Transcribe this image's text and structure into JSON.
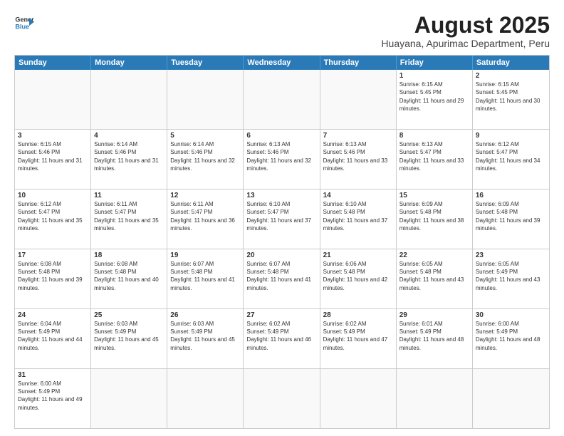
{
  "logo": {
    "line1": "General",
    "line2": "Blue"
  },
  "title": "August 2025",
  "subtitle": "Huayana, Apurimac Department, Peru",
  "headers": [
    "Sunday",
    "Monday",
    "Tuesday",
    "Wednesday",
    "Thursday",
    "Friday",
    "Saturday"
  ],
  "weeks": [
    [
      {
        "day": "",
        "info": ""
      },
      {
        "day": "",
        "info": ""
      },
      {
        "day": "",
        "info": ""
      },
      {
        "day": "",
        "info": ""
      },
      {
        "day": "",
        "info": ""
      },
      {
        "day": "1",
        "info": "Sunrise: 6:15 AM\nSunset: 5:45 PM\nDaylight: 11 hours and 29 minutes."
      },
      {
        "day": "2",
        "info": "Sunrise: 6:15 AM\nSunset: 5:45 PM\nDaylight: 11 hours and 30 minutes."
      }
    ],
    [
      {
        "day": "3",
        "info": "Sunrise: 6:15 AM\nSunset: 5:46 PM\nDaylight: 11 hours and 31 minutes."
      },
      {
        "day": "4",
        "info": "Sunrise: 6:14 AM\nSunset: 5:46 PM\nDaylight: 11 hours and 31 minutes."
      },
      {
        "day": "5",
        "info": "Sunrise: 6:14 AM\nSunset: 5:46 PM\nDaylight: 11 hours and 32 minutes."
      },
      {
        "day": "6",
        "info": "Sunrise: 6:13 AM\nSunset: 5:46 PM\nDaylight: 11 hours and 32 minutes."
      },
      {
        "day": "7",
        "info": "Sunrise: 6:13 AM\nSunset: 5:46 PM\nDaylight: 11 hours and 33 minutes."
      },
      {
        "day": "8",
        "info": "Sunrise: 6:13 AM\nSunset: 5:47 PM\nDaylight: 11 hours and 33 minutes."
      },
      {
        "day": "9",
        "info": "Sunrise: 6:12 AM\nSunset: 5:47 PM\nDaylight: 11 hours and 34 minutes."
      }
    ],
    [
      {
        "day": "10",
        "info": "Sunrise: 6:12 AM\nSunset: 5:47 PM\nDaylight: 11 hours and 35 minutes."
      },
      {
        "day": "11",
        "info": "Sunrise: 6:11 AM\nSunset: 5:47 PM\nDaylight: 11 hours and 35 minutes."
      },
      {
        "day": "12",
        "info": "Sunrise: 6:11 AM\nSunset: 5:47 PM\nDaylight: 11 hours and 36 minutes."
      },
      {
        "day": "13",
        "info": "Sunrise: 6:10 AM\nSunset: 5:47 PM\nDaylight: 11 hours and 37 minutes."
      },
      {
        "day": "14",
        "info": "Sunrise: 6:10 AM\nSunset: 5:48 PM\nDaylight: 11 hours and 37 minutes."
      },
      {
        "day": "15",
        "info": "Sunrise: 6:09 AM\nSunset: 5:48 PM\nDaylight: 11 hours and 38 minutes."
      },
      {
        "day": "16",
        "info": "Sunrise: 6:09 AM\nSunset: 5:48 PM\nDaylight: 11 hours and 39 minutes."
      }
    ],
    [
      {
        "day": "17",
        "info": "Sunrise: 6:08 AM\nSunset: 5:48 PM\nDaylight: 11 hours and 39 minutes."
      },
      {
        "day": "18",
        "info": "Sunrise: 6:08 AM\nSunset: 5:48 PM\nDaylight: 11 hours and 40 minutes."
      },
      {
        "day": "19",
        "info": "Sunrise: 6:07 AM\nSunset: 5:48 PM\nDaylight: 11 hours and 41 minutes."
      },
      {
        "day": "20",
        "info": "Sunrise: 6:07 AM\nSunset: 5:48 PM\nDaylight: 11 hours and 41 minutes."
      },
      {
        "day": "21",
        "info": "Sunrise: 6:06 AM\nSunset: 5:48 PM\nDaylight: 11 hours and 42 minutes."
      },
      {
        "day": "22",
        "info": "Sunrise: 6:05 AM\nSunset: 5:48 PM\nDaylight: 11 hours and 43 minutes."
      },
      {
        "day": "23",
        "info": "Sunrise: 6:05 AM\nSunset: 5:49 PM\nDaylight: 11 hours and 43 minutes."
      }
    ],
    [
      {
        "day": "24",
        "info": "Sunrise: 6:04 AM\nSunset: 5:49 PM\nDaylight: 11 hours and 44 minutes."
      },
      {
        "day": "25",
        "info": "Sunrise: 6:03 AM\nSunset: 5:49 PM\nDaylight: 11 hours and 45 minutes."
      },
      {
        "day": "26",
        "info": "Sunrise: 6:03 AM\nSunset: 5:49 PM\nDaylight: 11 hours and 45 minutes."
      },
      {
        "day": "27",
        "info": "Sunrise: 6:02 AM\nSunset: 5:49 PM\nDaylight: 11 hours and 46 minutes."
      },
      {
        "day": "28",
        "info": "Sunrise: 6:02 AM\nSunset: 5:49 PM\nDaylight: 11 hours and 47 minutes."
      },
      {
        "day": "29",
        "info": "Sunrise: 6:01 AM\nSunset: 5:49 PM\nDaylight: 11 hours and 48 minutes."
      },
      {
        "day": "30",
        "info": "Sunrise: 6:00 AM\nSunset: 5:49 PM\nDaylight: 11 hours and 48 minutes."
      }
    ],
    [
      {
        "day": "31",
        "info": "Sunrise: 6:00 AM\nSunset: 5:49 PM\nDaylight: 11 hours and 49 minutes."
      },
      {
        "day": "",
        "info": ""
      },
      {
        "day": "",
        "info": ""
      },
      {
        "day": "",
        "info": ""
      },
      {
        "day": "",
        "info": ""
      },
      {
        "day": "",
        "info": ""
      },
      {
        "day": "",
        "info": ""
      }
    ]
  ]
}
